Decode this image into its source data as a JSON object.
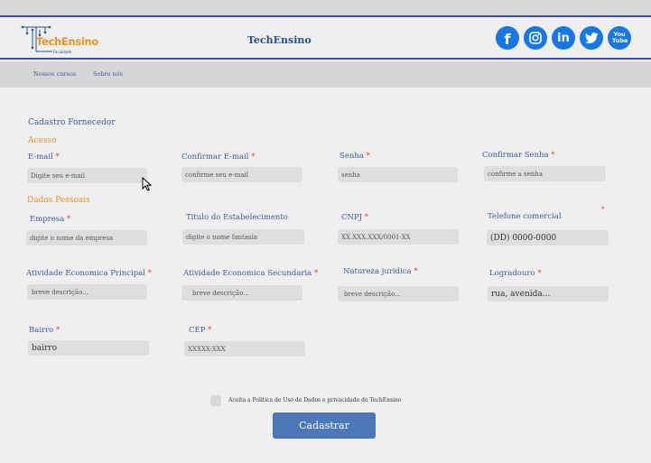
{
  "brand": {
    "logo_text": "TechEnsino",
    "logo_subtext": "Faculdade",
    "title": "TechEnsino"
  },
  "social": [
    {
      "name": "facebook",
      "glyph": "f"
    },
    {
      "name": "instagram",
      "glyph": ""
    },
    {
      "name": "linkedin",
      "glyph": "in"
    },
    {
      "name": "twitter",
      "glyph": ""
    },
    {
      "name": "youtube",
      "glyph": "You Tube"
    }
  ],
  "nav": {
    "courses": "Nossos cursos",
    "about": "Sobre nós"
  },
  "form": {
    "title": "Cadastro Fornecedor",
    "access_section": "Acesso",
    "personal_section": "Dados Pessoais",
    "required_mark": "*",
    "fields": {
      "email": {
        "label": "E-mail",
        "placeholder": "Digite seu e-mail"
      },
      "confirm_email": {
        "label": "Confirmar E-mail",
        "placeholder": "confirme seu e-mail"
      },
      "password": {
        "label": "Senha",
        "placeholder": "senha"
      },
      "confirm_password": {
        "label": "Confirmar Senha",
        "placeholder": "confirme a senha"
      },
      "company": {
        "label": "Empresa",
        "placeholder": "digite o nome da empresa"
      },
      "establishment": {
        "label": "Titulo do Estabelecimento",
        "placeholder": "digite o nome fantasia"
      },
      "cnpj": {
        "label": "CNPJ",
        "placeholder": "XX.XXX.XXX/0001-XX"
      },
      "phone": {
        "label": "Telefone comercial",
        "placeholder": "(DD) 0000-0000"
      },
      "main_activity": {
        "label": "Atividade Economica Principal",
        "placeholder": "breve descrição..."
      },
      "secondary_activity": {
        "label": "Atividade Economica Secundaria",
        "placeholder": "breve descrição..."
      },
      "legal_nature": {
        "label": "Natureza juridica",
        "placeholder": "breve descrição..."
      },
      "street": {
        "label": "Logradouro",
        "placeholder": "rua, avenida..."
      },
      "neighborhood": {
        "label": "Bairro",
        "placeholder": "bairro"
      },
      "cep": {
        "label": "CEP",
        "placeholder": "XXXXX-XXX"
      }
    },
    "consent": "Aceita a Politica de Uso de Dados e privacidade do TechEnsino",
    "submit": "Cadastrar"
  },
  "colors": {
    "accent_blue": "#3a5a9c",
    "accent_orange": "#e8922c",
    "button": "#4a78b8",
    "required": "#e0342c",
    "social": "#1877e8"
  }
}
